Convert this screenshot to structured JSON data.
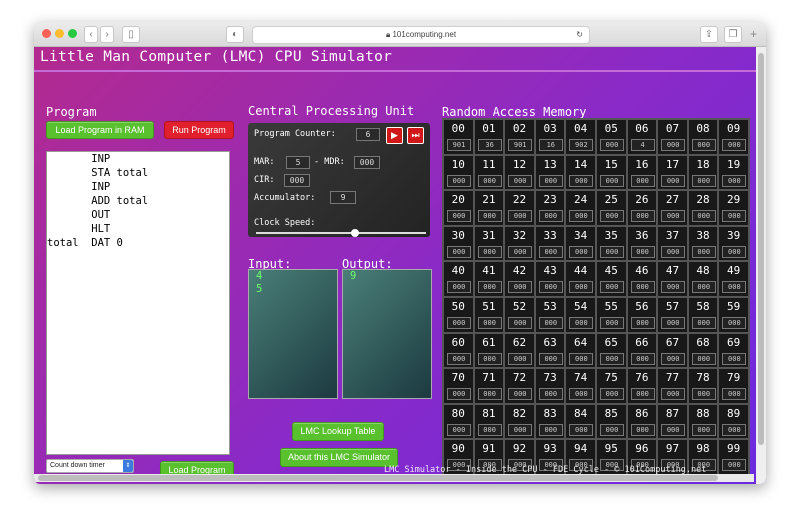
{
  "browser": {
    "url": "101computing.net",
    "back_icon": "chevron-left-icon",
    "forward_icon": "chevron-right-icon"
  },
  "page": {
    "title": "Little Man Computer (LMC) CPU Simulator",
    "footer": "LMC Simulator - Inside the CPU - FDE Cycle - © 101Computing.net"
  },
  "program": {
    "heading": "Program",
    "load_ram_label": "Load Program in RAM",
    "run_label": "Run Program",
    "code_lines": [
      "       INP",
      "       STA total",
      "       INP",
      "       ADD total",
      "       OUT",
      "       HLT",
      "total  DAT 0"
    ],
    "timer_select": "Count down timer",
    "load_program_label": "Load Program"
  },
  "cpu": {
    "heading": "Central Processing Unit",
    "pc_label": "Program Counter:",
    "pc_value": "6",
    "mar_label": "MAR:",
    "mar_value": "5",
    "mdr_label": "- MDR:",
    "mdr_value": "000",
    "cir_label": "CIR:",
    "cir_value": "000",
    "acc_label": "Accumulator:",
    "acc_value": "9",
    "clock_label": "Clock Speed:",
    "clock_speed": 0.58,
    "play_icon": "play-icon",
    "step_icon": "step-icon"
  },
  "io": {
    "input_label": "Input:",
    "output_label": "Output:",
    "input_values": [
      "4",
      "5"
    ],
    "output_values": [
      "9"
    ]
  },
  "buttons": {
    "lookup_label": "LMC Lookup Table",
    "about_label": "About this LMC Simulator"
  },
  "ram": {
    "heading": "Random Access Memory",
    "values": [
      "901",
      "36",
      "901",
      "16",
      "902",
      "000",
      "4",
      "000",
      "000",
      "000"
    ]
  }
}
